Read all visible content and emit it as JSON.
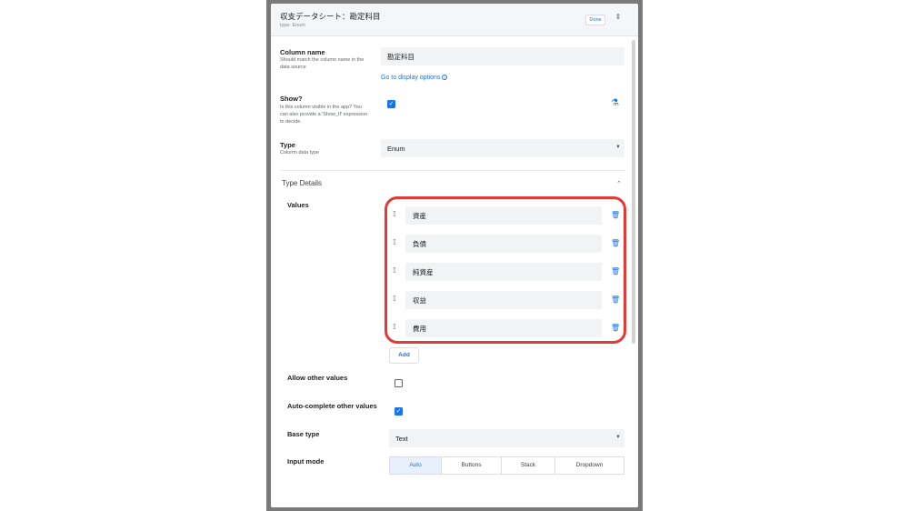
{
  "header": {
    "title": "収支データシート：勘定科目",
    "subtitle": "type: Enum",
    "done_label": "Done",
    "updown_icon": "⇕"
  },
  "column_name": {
    "label": "Column name",
    "hint": "Should match the column name in the data source",
    "value": "勘定科目",
    "display_link": "Go to display options",
    "info_icon": "i"
  },
  "show": {
    "label": "Show?",
    "hint": "Is this column visible in the app? You can also provide a 'Show_If' expression to decide.",
    "checked": true
  },
  "type": {
    "label": "Type",
    "hint": "Column data type",
    "value": "Enum"
  },
  "type_details": {
    "title": "Type Details",
    "values_label": "Values",
    "values": [
      "資産",
      "負債",
      "純資産",
      "収益",
      "費用"
    ],
    "add_label": "Add",
    "allow_other_label": "Allow other values",
    "allow_other_checked": false,
    "autocomplete_label": "Auto-complete other values",
    "autocomplete_checked": true,
    "base_type_label": "Base type",
    "base_type_value": "Text",
    "input_mode_label": "Input mode",
    "input_modes": [
      "Auto",
      "Buttons",
      "Stack",
      "Dropdown"
    ],
    "input_mode_selected": "Auto"
  },
  "colors": {
    "accent": "#1a73e8",
    "highlight": "#e53935"
  }
}
